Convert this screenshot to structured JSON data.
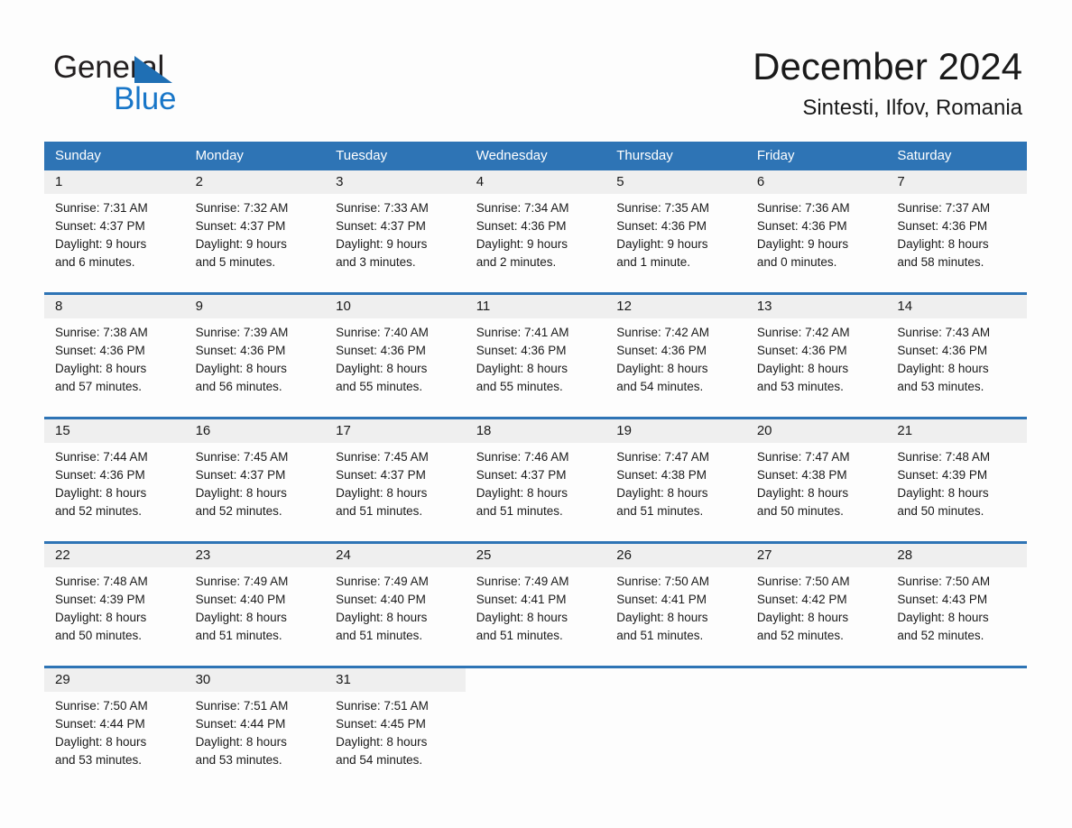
{
  "brand": {
    "name_part1": "General",
    "name_part2": "Blue",
    "triangle_color": "#1f6fb4",
    "blue_color": "#1876c8"
  },
  "header": {
    "title": "December 2024",
    "location": "Sintesti, Ilfov, Romania"
  },
  "colors": {
    "header_band": "#2e74b5",
    "day_band": "#efefef",
    "week_rule": "#2e74b5",
    "text": "#1a1a1a"
  },
  "weekdays": [
    "Sunday",
    "Monday",
    "Tuesday",
    "Wednesday",
    "Thursday",
    "Friday",
    "Saturday"
  ],
  "days": [
    {
      "n": "1",
      "sunrise": "Sunrise: 7:31 AM",
      "sunset": "Sunset: 4:37 PM",
      "daylight1": "Daylight: 9 hours",
      "daylight2": "and 6 minutes."
    },
    {
      "n": "2",
      "sunrise": "Sunrise: 7:32 AM",
      "sunset": "Sunset: 4:37 PM",
      "daylight1": "Daylight: 9 hours",
      "daylight2": "and 5 minutes."
    },
    {
      "n": "3",
      "sunrise": "Sunrise: 7:33 AM",
      "sunset": "Sunset: 4:37 PM",
      "daylight1": "Daylight: 9 hours",
      "daylight2": "and 3 minutes."
    },
    {
      "n": "4",
      "sunrise": "Sunrise: 7:34 AM",
      "sunset": "Sunset: 4:36 PM",
      "daylight1": "Daylight: 9 hours",
      "daylight2": "and 2 minutes."
    },
    {
      "n": "5",
      "sunrise": "Sunrise: 7:35 AM",
      "sunset": "Sunset: 4:36 PM",
      "daylight1": "Daylight: 9 hours",
      "daylight2": "and 1 minute."
    },
    {
      "n": "6",
      "sunrise": "Sunrise: 7:36 AM",
      "sunset": "Sunset: 4:36 PM",
      "daylight1": "Daylight: 9 hours",
      "daylight2": "and 0 minutes."
    },
    {
      "n": "7",
      "sunrise": "Sunrise: 7:37 AM",
      "sunset": "Sunset: 4:36 PM",
      "daylight1": "Daylight: 8 hours",
      "daylight2": "and 58 minutes."
    },
    {
      "n": "8",
      "sunrise": "Sunrise: 7:38 AM",
      "sunset": "Sunset: 4:36 PM",
      "daylight1": "Daylight: 8 hours",
      "daylight2": "and 57 minutes."
    },
    {
      "n": "9",
      "sunrise": "Sunrise: 7:39 AM",
      "sunset": "Sunset: 4:36 PM",
      "daylight1": "Daylight: 8 hours",
      "daylight2": "and 56 minutes."
    },
    {
      "n": "10",
      "sunrise": "Sunrise: 7:40 AM",
      "sunset": "Sunset: 4:36 PM",
      "daylight1": "Daylight: 8 hours",
      "daylight2": "and 55 minutes."
    },
    {
      "n": "11",
      "sunrise": "Sunrise: 7:41 AM",
      "sunset": "Sunset: 4:36 PM",
      "daylight1": "Daylight: 8 hours",
      "daylight2": "and 55 minutes."
    },
    {
      "n": "12",
      "sunrise": "Sunrise: 7:42 AM",
      "sunset": "Sunset: 4:36 PM",
      "daylight1": "Daylight: 8 hours",
      "daylight2": "and 54 minutes."
    },
    {
      "n": "13",
      "sunrise": "Sunrise: 7:42 AM",
      "sunset": "Sunset: 4:36 PM",
      "daylight1": "Daylight: 8 hours",
      "daylight2": "and 53 minutes."
    },
    {
      "n": "14",
      "sunrise": "Sunrise: 7:43 AM",
      "sunset": "Sunset: 4:36 PM",
      "daylight1": "Daylight: 8 hours",
      "daylight2": "and 53 minutes."
    },
    {
      "n": "15",
      "sunrise": "Sunrise: 7:44 AM",
      "sunset": "Sunset: 4:36 PM",
      "daylight1": "Daylight: 8 hours",
      "daylight2": "and 52 minutes."
    },
    {
      "n": "16",
      "sunrise": "Sunrise: 7:45 AM",
      "sunset": "Sunset: 4:37 PM",
      "daylight1": "Daylight: 8 hours",
      "daylight2": "and 52 minutes."
    },
    {
      "n": "17",
      "sunrise": "Sunrise: 7:45 AM",
      "sunset": "Sunset: 4:37 PM",
      "daylight1": "Daylight: 8 hours",
      "daylight2": "and 51 minutes."
    },
    {
      "n": "18",
      "sunrise": "Sunrise: 7:46 AM",
      "sunset": "Sunset: 4:37 PM",
      "daylight1": "Daylight: 8 hours",
      "daylight2": "and 51 minutes."
    },
    {
      "n": "19",
      "sunrise": "Sunrise: 7:47 AM",
      "sunset": "Sunset: 4:38 PM",
      "daylight1": "Daylight: 8 hours",
      "daylight2": "and 51 minutes."
    },
    {
      "n": "20",
      "sunrise": "Sunrise: 7:47 AM",
      "sunset": "Sunset: 4:38 PM",
      "daylight1": "Daylight: 8 hours",
      "daylight2": "and 50 minutes."
    },
    {
      "n": "21",
      "sunrise": "Sunrise: 7:48 AM",
      "sunset": "Sunset: 4:39 PM",
      "daylight1": "Daylight: 8 hours",
      "daylight2": "and 50 minutes."
    },
    {
      "n": "22",
      "sunrise": "Sunrise: 7:48 AM",
      "sunset": "Sunset: 4:39 PM",
      "daylight1": "Daylight: 8 hours",
      "daylight2": "and 50 minutes."
    },
    {
      "n": "23",
      "sunrise": "Sunrise: 7:49 AM",
      "sunset": "Sunset: 4:40 PM",
      "daylight1": "Daylight: 8 hours",
      "daylight2": "and 51 minutes."
    },
    {
      "n": "24",
      "sunrise": "Sunrise: 7:49 AM",
      "sunset": "Sunset: 4:40 PM",
      "daylight1": "Daylight: 8 hours",
      "daylight2": "and 51 minutes."
    },
    {
      "n": "25",
      "sunrise": "Sunrise: 7:49 AM",
      "sunset": "Sunset: 4:41 PM",
      "daylight1": "Daylight: 8 hours",
      "daylight2": "and 51 minutes."
    },
    {
      "n": "26",
      "sunrise": "Sunrise: 7:50 AM",
      "sunset": "Sunset: 4:41 PM",
      "daylight1": "Daylight: 8 hours",
      "daylight2": "and 51 minutes."
    },
    {
      "n": "27",
      "sunrise": "Sunrise: 7:50 AM",
      "sunset": "Sunset: 4:42 PM",
      "daylight1": "Daylight: 8 hours",
      "daylight2": "and 52 minutes."
    },
    {
      "n": "28",
      "sunrise": "Sunrise: 7:50 AM",
      "sunset": "Sunset: 4:43 PM",
      "daylight1": "Daylight: 8 hours",
      "daylight2": "and 52 minutes."
    },
    {
      "n": "29",
      "sunrise": "Sunrise: 7:50 AM",
      "sunset": "Sunset: 4:44 PM",
      "daylight1": "Daylight: 8 hours",
      "daylight2": "and 53 minutes."
    },
    {
      "n": "30",
      "sunrise": "Sunrise: 7:51 AM",
      "sunset": "Sunset: 4:44 PM",
      "daylight1": "Daylight: 8 hours",
      "daylight2": "and 53 minutes."
    },
    {
      "n": "31",
      "sunrise": "Sunrise: 7:51 AM",
      "sunset": "Sunset: 4:45 PM",
      "daylight1": "Daylight: 8 hours",
      "daylight2": "and 54 minutes."
    }
  ],
  "grid": {
    "leading_blanks": 0,
    "trailing_blanks_last_row": 4,
    "weeks": 5
  }
}
